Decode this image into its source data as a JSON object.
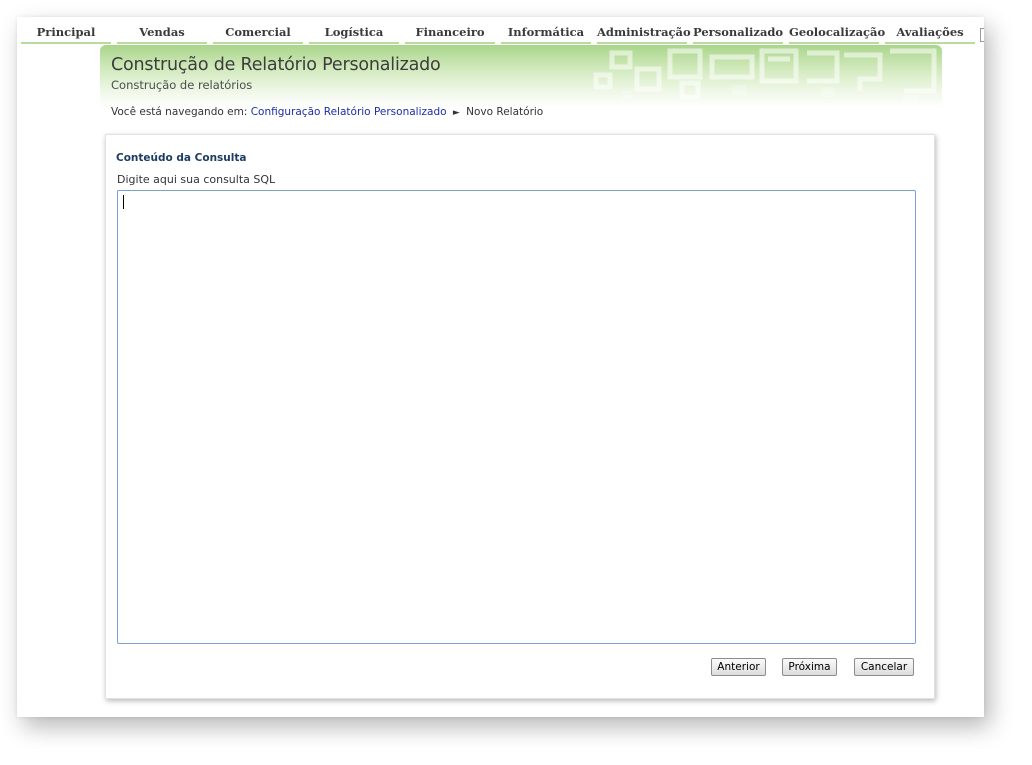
{
  "nav": {
    "items": [
      {
        "label": "Principal"
      },
      {
        "label": "Vendas"
      },
      {
        "label": "Comercial"
      },
      {
        "label": "Logística"
      },
      {
        "label": "Financeiro"
      },
      {
        "label": "Informática"
      },
      {
        "label": "Administração"
      },
      {
        "label": "Personalizado"
      },
      {
        "label": "Geolocalização"
      },
      {
        "label": "Avaliações"
      }
    ]
  },
  "header": {
    "title": "Construção de Relatório Personalizado",
    "subtitle": "Construção de relatórios"
  },
  "breadcrumb": {
    "prefix": "Você está navegando em:",
    "link": "Configuração Relatório Personalizado",
    "separator": "►",
    "current": "Novo Relatório"
  },
  "form": {
    "section_title": "Conteúdo da Consulta",
    "sql_label": "Digite aqui sua consulta SQL",
    "sql_value": ""
  },
  "buttons": {
    "previous": "Anterior",
    "next": "Próxima",
    "cancel": "Cancelar"
  },
  "colors": {
    "accent_green": "#a9d58b",
    "nav_underline": "#b8dca0",
    "section_title": "#1d3c61",
    "link": "#1a2fa8",
    "input_border": "#7b9fd6"
  }
}
